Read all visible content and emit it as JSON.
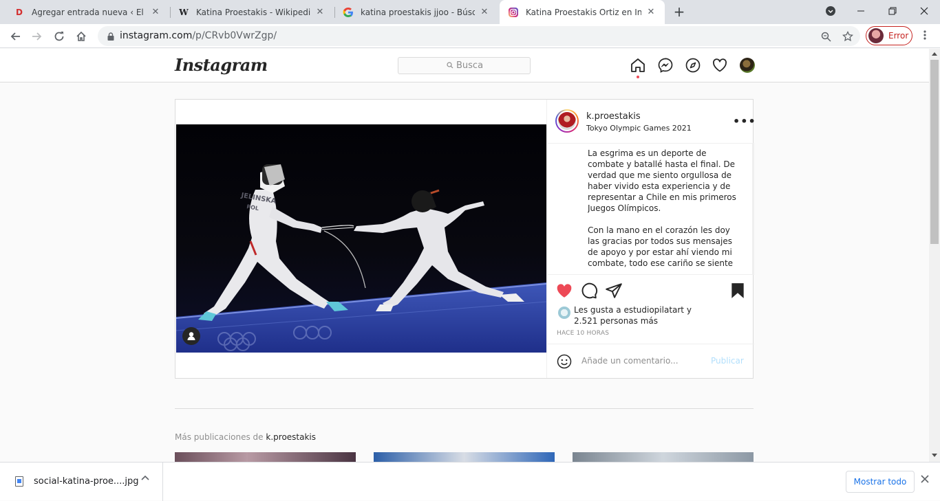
{
  "browser": {
    "tabs": [
      {
        "title": "Agregar entrada nueva ‹ El Diario",
        "favicon": "D"
      },
      {
        "title": "Katina Proestakis - Wikipedia, la e",
        "favicon": "W"
      },
      {
        "title": "katina proestakis jjoo - Búsqueda",
        "favicon": "G"
      },
      {
        "title": "Katina Proestakis Ortiz en Instagr",
        "favicon": "IG"
      }
    ],
    "close_glyph": "✕",
    "new_tab_glyph": "+",
    "url_host": "instagram.com",
    "url_path": "/p/CRvb0VwrZgp/",
    "profile_status": "Error"
  },
  "instagram": {
    "logo": "Instagram",
    "search_placeholder": "Busca",
    "post": {
      "username": "k.proestakis",
      "location": "Tokyo Olympic Games 2021",
      "more_glyph": "•••",
      "caption_p1": "La esgrima es un deporte de combate y batallé hasta el final. De verdad que me siento orgullosa de haber vivido esta experiencia y de representar a Chile en mis primeros Juegos Olímpicos.",
      "caption_p2": "Con la mano en el corazón les doy las gracias por todos sus mensajes de apoyo y por estar ahí viendo mi combate, todo ese cariño se siente",
      "likes_text": "Les gusta a estudiopilatart y 2.521 personas más",
      "time": "HACE 10 HORAS",
      "comment_placeholder": "Añade un comentario...",
      "publish_label": "Publicar",
      "jersey_text": "JELINSKA",
      "jersey_country": "POL"
    },
    "more_posts_label": "Más publicaciones de",
    "more_posts_user": "k.proestakis"
  },
  "download": {
    "file_name": "social-katina-proe....jpg",
    "show_all": "Mostrar todo"
  },
  "colors": {
    "heart": "#ed4956",
    "profile_error": "#c5221f",
    "publish": "#b2dffc"
  }
}
